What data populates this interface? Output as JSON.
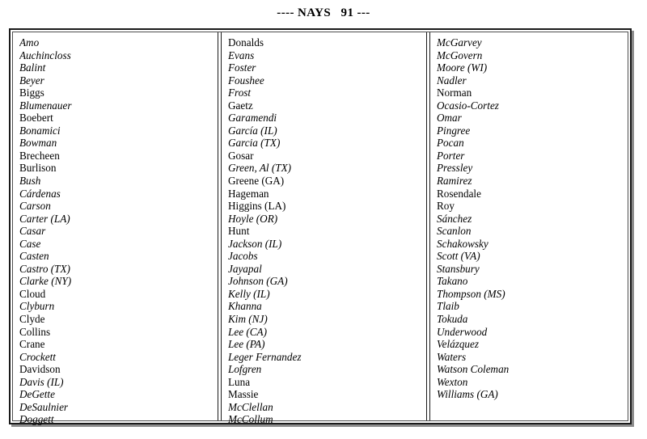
{
  "heading": {
    "text": "---- NAYS   91 ---",
    "vote_label": "NAYS",
    "vote_count": "91",
    "leading_dashes": "----",
    "trailing_dashes": "---"
  },
  "columns": [
    {
      "index": 1,
      "names": [
        {
          "name": "Amo",
          "style": "italic"
        },
        {
          "name": "Auchincloss",
          "style": "italic"
        },
        {
          "name": "Balint",
          "style": "italic"
        },
        {
          "name": "Beyer",
          "style": "italic"
        },
        {
          "name": "Biggs",
          "style": "roman"
        },
        {
          "name": "Blumenauer",
          "style": "italic"
        },
        {
          "name": "Boebert",
          "style": "roman"
        },
        {
          "name": "Bonamici",
          "style": "italic"
        },
        {
          "name": "Bowman",
          "style": "italic"
        },
        {
          "name": "Brecheen",
          "style": "roman"
        },
        {
          "name": "Burlison",
          "style": "roman"
        },
        {
          "name": "Bush",
          "style": "italic"
        },
        {
          "name": "Cárdenas",
          "style": "italic"
        },
        {
          "name": "Carson",
          "style": "italic"
        },
        {
          "name": "Carter (LA)",
          "style": "italic"
        },
        {
          "name": "Casar",
          "style": "italic"
        },
        {
          "name": "Case",
          "style": "italic"
        },
        {
          "name": "Casten",
          "style": "italic"
        },
        {
          "name": "Castro (TX)",
          "style": "italic"
        },
        {
          "name": "Clarke (NY)",
          "style": "italic"
        },
        {
          "name": "Cloud",
          "style": "roman"
        },
        {
          "name": "Clyburn",
          "style": "italic"
        },
        {
          "name": "Clyde",
          "style": "roman"
        },
        {
          "name": "Collins",
          "style": "roman"
        },
        {
          "name": "Crane",
          "style": "roman"
        },
        {
          "name": "Crockett",
          "style": "italic"
        },
        {
          "name": "Davidson",
          "style": "roman"
        },
        {
          "name": "Davis (IL)",
          "style": "italic"
        },
        {
          "name": "DeGette",
          "style": "italic"
        },
        {
          "name": "DeSaulnier",
          "style": "italic"
        },
        {
          "name": "Doggett",
          "style": "italic"
        }
      ]
    },
    {
      "index": 2,
      "names": [
        {
          "name": "Donalds",
          "style": "roman"
        },
        {
          "name": "Evans",
          "style": "italic"
        },
        {
          "name": "Foster",
          "style": "italic"
        },
        {
          "name": "Foushee",
          "style": "italic"
        },
        {
          "name": "Frost",
          "style": "italic"
        },
        {
          "name": "Gaetz",
          "style": "roman"
        },
        {
          "name": "Garamendi",
          "style": "italic"
        },
        {
          "name": "García (IL)",
          "style": "italic"
        },
        {
          "name": "Garcia (TX)",
          "style": "italic"
        },
        {
          "name": "Gosar",
          "style": "roman"
        },
        {
          "name": "Green, Al (TX)",
          "style": "italic"
        },
        {
          "name": "Greene (GA)",
          "style": "roman"
        },
        {
          "name": "Hageman",
          "style": "roman"
        },
        {
          "name": "Higgins (LA)",
          "style": "roman"
        },
        {
          "name": "Hoyle (OR)",
          "style": "italic"
        },
        {
          "name": "Hunt",
          "style": "roman"
        },
        {
          "name": "Jackson (IL)",
          "style": "italic"
        },
        {
          "name": "Jacobs",
          "style": "italic"
        },
        {
          "name": "Jayapal",
          "style": "italic"
        },
        {
          "name": "Johnson (GA)",
          "style": "italic"
        },
        {
          "name": "Kelly (IL)",
          "style": "italic"
        },
        {
          "name": "Khanna",
          "style": "italic"
        },
        {
          "name": "Kim (NJ)",
          "style": "italic"
        },
        {
          "name": "Lee (CA)",
          "style": "italic"
        },
        {
          "name": "Lee (PA)",
          "style": "italic"
        },
        {
          "name": "Leger Fernandez",
          "style": "italic"
        },
        {
          "name": "Lofgren",
          "style": "italic"
        },
        {
          "name": "Luna",
          "style": "roman"
        },
        {
          "name": "Massie",
          "style": "roman"
        },
        {
          "name": "McClellan",
          "style": "italic"
        },
        {
          "name": "McCollum",
          "style": "italic"
        }
      ]
    },
    {
      "index": 3,
      "names": [
        {
          "name": "McGarvey",
          "style": "italic"
        },
        {
          "name": "McGovern",
          "style": "italic"
        },
        {
          "name": "Moore (WI)",
          "style": "italic"
        },
        {
          "name": "Nadler",
          "style": "italic"
        },
        {
          "name": "Norman",
          "style": "roman"
        },
        {
          "name": "Ocasio-Cortez",
          "style": "italic"
        },
        {
          "name": "Omar",
          "style": "italic"
        },
        {
          "name": "Pingree",
          "style": "italic"
        },
        {
          "name": "Pocan",
          "style": "italic"
        },
        {
          "name": "Porter",
          "style": "italic"
        },
        {
          "name": "Pressley",
          "style": "italic"
        },
        {
          "name": "Ramirez",
          "style": "italic"
        },
        {
          "name": "Rosendale",
          "style": "roman"
        },
        {
          "name": "Roy",
          "style": "roman"
        },
        {
          "name": "Sánchez",
          "style": "italic"
        },
        {
          "name": "Scanlon",
          "style": "italic"
        },
        {
          "name": "Schakowsky",
          "style": "italic"
        },
        {
          "name": "Scott (VA)",
          "style": "italic"
        },
        {
          "name": "Stansbury",
          "style": "italic"
        },
        {
          "name": "Takano",
          "style": "italic"
        },
        {
          "name": "Thompson (MS)",
          "style": "italic"
        },
        {
          "name": "Tlaib",
          "style": "italic"
        },
        {
          "name": "Tokuda",
          "style": "italic"
        },
        {
          "name": "Underwood",
          "style": "italic"
        },
        {
          "name": "Velázquez",
          "style": "italic"
        },
        {
          "name": "Waters",
          "style": "italic"
        },
        {
          "name": "Watson Coleman",
          "style": "italic"
        },
        {
          "name": "Wexton",
          "style": "italic"
        },
        {
          "name": "Williams (GA)",
          "style": "italic"
        }
      ]
    }
  ]
}
